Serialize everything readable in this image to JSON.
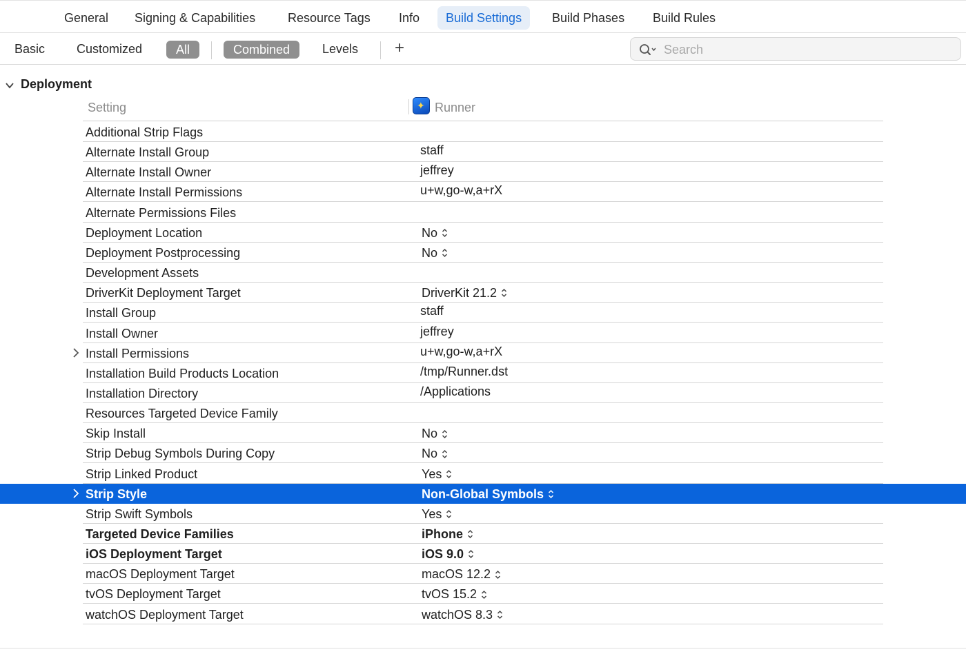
{
  "tabs": [
    {
      "label": "General",
      "active": false
    },
    {
      "label": "Signing & Capabilities",
      "active": false
    },
    {
      "label": "Resource Tags",
      "active": false
    },
    {
      "label": "Info",
      "active": false
    },
    {
      "label": "Build Settings",
      "active": true
    },
    {
      "label": "Build Phases",
      "active": false
    },
    {
      "label": "Build Rules",
      "active": false
    }
  ],
  "filters": {
    "basic": "Basic",
    "customized": "Customized",
    "all": "All",
    "combined": "Combined",
    "levels": "Levels",
    "add": "+"
  },
  "search": {
    "placeholder": "Search",
    "value": ""
  },
  "section": {
    "title": "Deployment",
    "expanded": true
  },
  "columns": {
    "setting": "Setting",
    "target": "Runner"
  },
  "colors": {
    "accent": "#1a6cd6",
    "selection": "#0a64dc",
    "pill": "#8f8f8f"
  },
  "settings": [
    {
      "name": "Additional Strip Flags",
      "value": "",
      "popup": false
    },
    {
      "name": "Alternate Install Group",
      "value": "staff",
      "popup": false
    },
    {
      "name": "Alternate Install Owner",
      "value": "jeffrey",
      "popup": false
    },
    {
      "name": "Alternate Install Permissions",
      "value": "u+w,go-w,a+rX",
      "popup": false
    },
    {
      "name": "Alternate Permissions Files",
      "value": "",
      "popup": false
    },
    {
      "name": "Deployment Location",
      "value": "No",
      "popup": true
    },
    {
      "name": "Deployment Postprocessing",
      "value": "No",
      "popup": true
    },
    {
      "name": "Development Assets",
      "value": "",
      "popup": false
    },
    {
      "name": "DriverKit Deployment Target",
      "value": "DriverKit 21.2",
      "popup": true
    },
    {
      "name": "Install Group",
      "value": "staff",
      "popup": false
    },
    {
      "name": "Install Owner",
      "value": "jeffrey",
      "popup": false
    },
    {
      "name": "Install Permissions",
      "value": "u+w,go-w,a+rX",
      "popup": false,
      "expandable": true
    },
    {
      "name": "Installation Build Products Location",
      "value": "/tmp/Runner.dst",
      "popup": false
    },
    {
      "name": "Installation Directory",
      "value": "/Applications",
      "popup": false
    },
    {
      "name": "Resources Targeted Device Family",
      "value": "",
      "popup": false
    },
    {
      "name": "Skip Install",
      "value": "No",
      "popup": true
    },
    {
      "name": "Strip Debug Symbols During Copy",
      "value": "No",
      "popup": true
    },
    {
      "name": "Strip Linked Product",
      "value": "Yes",
      "popup": true
    },
    {
      "name": "Strip Style",
      "value": "Non-Global Symbols",
      "popup": true,
      "expandable": true,
      "selected": true
    },
    {
      "name": "Strip Swift Symbols",
      "value": "Yes",
      "popup": true
    },
    {
      "name": "Targeted Device Families",
      "value": "iPhone",
      "popup": true,
      "bold": true
    },
    {
      "name": "iOS Deployment Target",
      "value": "iOS 9.0",
      "popup": true,
      "bold": true
    },
    {
      "name": "macOS Deployment Target",
      "value": "macOS 12.2",
      "popup": true
    },
    {
      "name": "tvOS Deployment Target",
      "value": "tvOS 15.2",
      "popup": true
    },
    {
      "name": "watchOS Deployment Target",
      "value": "watchOS 8.3",
      "popup": true
    }
  ]
}
